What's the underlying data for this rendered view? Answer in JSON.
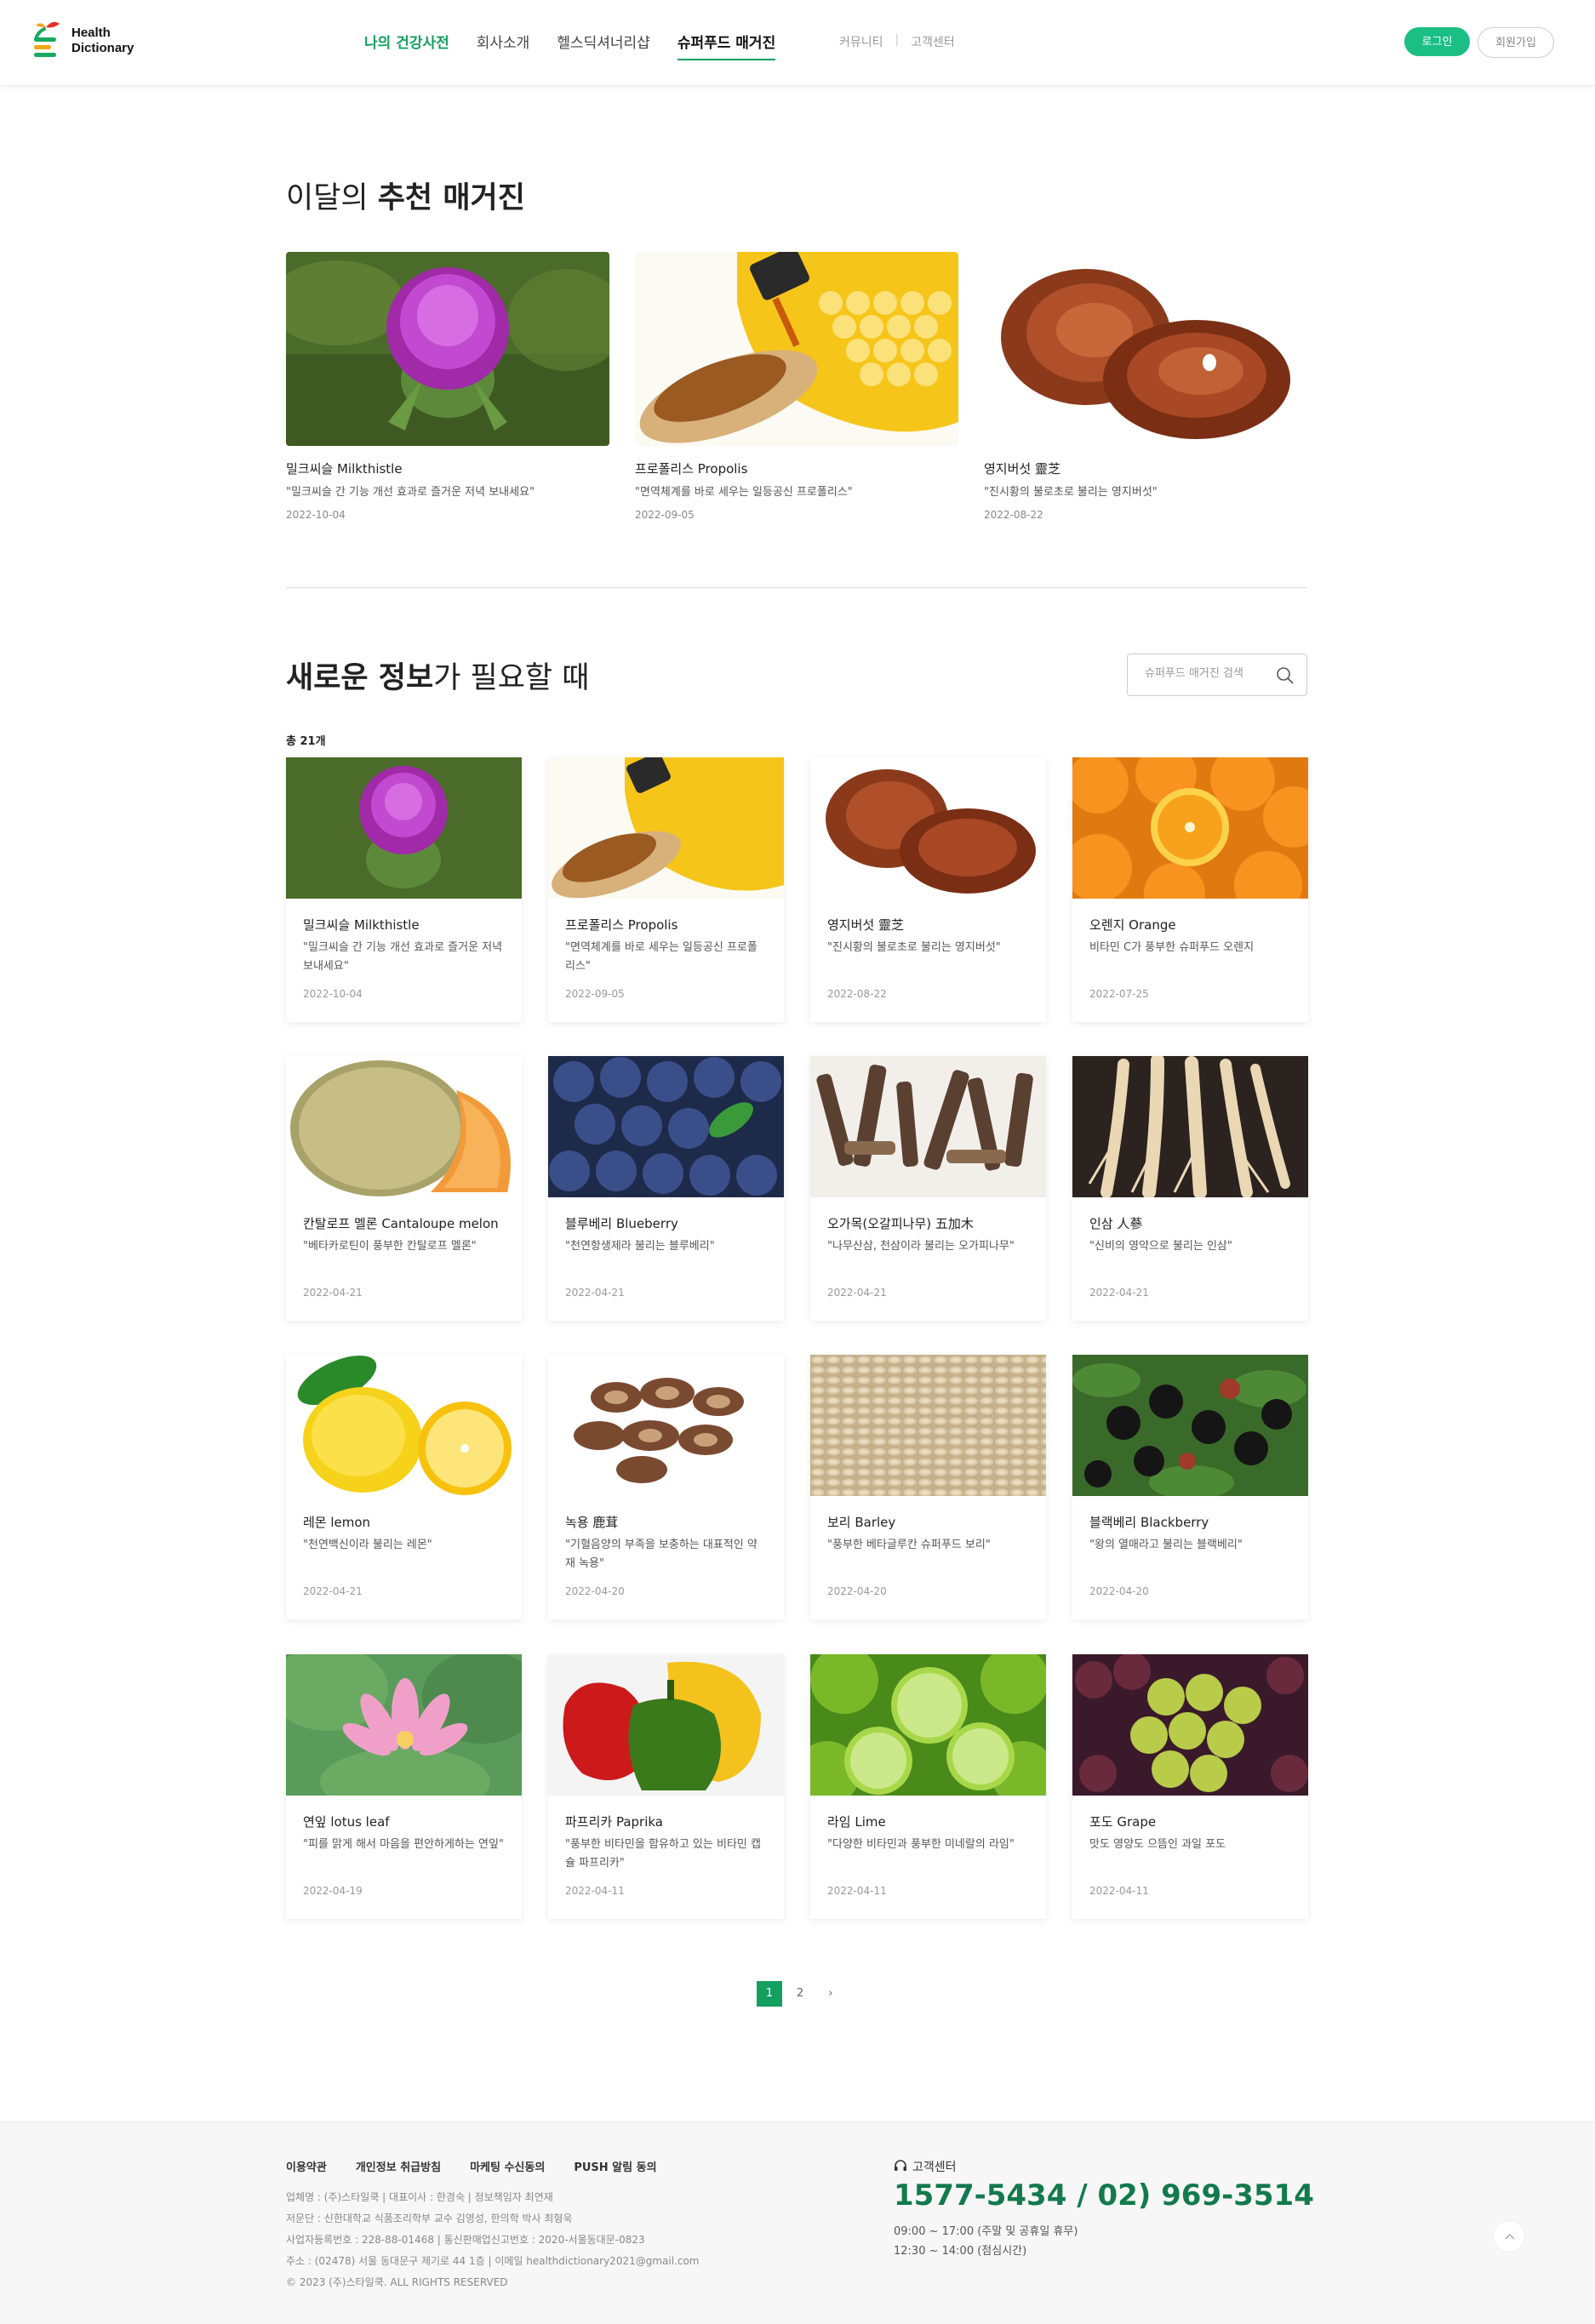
{
  "header": {
    "logo_line1": "Health",
    "logo_line2": "Dictionary",
    "nav": [
      "나의 건강사전",
      "회사소개",
      "헬스딕셔너리샵",
      "슈퍼푸드 매거진"
    ],
    "subnav": [
      "커뮤니티",
      "고객센터"
    ],
    "login": "로그인",
    "join": "회원가입"
  },
  "featured": {
    "title_prefix": "이달의 ",
    "title_bold": "추천 매거진",
    "items": [
      {
        "name": "밀크씨슬 Milkthistle",
        "desc": "\"밀크씨슬 간 기능 개선 효과로 즐거운 저녁 보내세요\"",
        "date": "2022-10-04",
        "icon": "milkthistle-image"
      },
      {
        "name": "프로폴리스 Propolis",
        "desc": "\"면역체계를 바로 세우는 일등공신 프로폴리스\"",
        "date": "2022-09-05",
        "icon": "propolis-image"
      },
      {
        "name": "영지버섯 靈芝",
        "desc": "\"진시황의 불로초로 불리는 영지버섯\"",
        "date": "2022-08-22",
        "icon": "reishi-image"
      }
    ]
  },
  "list": {
    "title_bold": "새로운 정보",
    "title_rest": "가 필요할 때",
    "search_placeholder": "슈퍼푸드 매거진 검색",
    "count": "총 21개",
    "items": [
      {
        "name": "밀크씨슬 Milkthistle",
        "desc": "\"밀크씨슬 간 기능 개선 효과로 즐거운 저녁 보내세요\"",
        "date": "2022-10-04"
      },
      {
        "name": "프로폴리스 Propolis",
        "desc": "\"면역체계를 바로 세우는 일등공신 프로폴리스\"",
        "date": "2022-09-05"
      },
      {
        "name": "영지버섯 靈芝",
        "desc": "\"진시황의 불로초로 불리는 영지버섯\"",
        "date": "2022-08-22"
      },
      {
        "name": "오렌지 Orange",
        "desc": "비타민 C가 풍부한 슈퍼푸드 오렌지",
        "date": "2022-07-25"
      },
      {
        "name": "칸탈로프 멜론 Cantaloupe melon",
        "desc": "\"베타카로틴이 풍부한 칸탈로프 멜론\"",
        "date": "2022-04-21"
      },
      {
        "name": "블루베리 Blueberry",
        "desc": "\"천연항생제라 불리는 블루베리\"",
        "date": "2022-04-21"
      },
      {
        "name": "오가목(오갈피나무) 五加木",
        "desc": "\"나무산삼, 천삼이라 불리는 오가피나무\"",
        "date": "2022-04-21"
      },
      {
        "name": "인삼 人蔘",
        "desc": "\"신비의 영약으로 불리는 인삼\"",
        "date": "2022-04-21"
      },
      {
        "name": "레몬 lemon",
        "desc": "\"천연백신이라 불리는 레몬\"",
        "date": "2022-04-21"
      },
      {
        "name": "녹용 鹿茸",
        "desc": "\"기혈음양의 부족을 보충하는 대표적인 약재 녹용\"",
        "date": "2022-04-20"
      },
      {
        "name": "보리 Barley",
        "desc": "\"풍부한 베타글루칸 슈퍼푸드 보리\"",
        "date": "2022-04-20"
      },
      {
        "name": "블랙베리 Blackberry",
        "desc": "\"왕의 열매라고 불리는 블랙베리\"",
        "date": "2022-04-20"
      },
      {
        "name": "연잎 lotus leaf",
        "desc": "\"피를 맑게 해서 마음을 편안하게하는 연잎\"",
        "date": "2022-04-19"
      },
      {
        "name": "파프리카 Paprika",
        "desc": "\"풍부한 비타민을 함유하고 있는 비타민 캡슐 파프리카\"",
        "date": "2022-04-11"
      },
      {
        "name": "라임 Lime",
        "desc": "\"다양한 비타민과 풍부한 미네랄의 라임\"",
        "date": "2022-04-11"
      },
      {
        "name": "포도 Grape",
        "desc": "맛도 영양도 으뜸인 과일 포도",
        "date": "2022-04-11"
      }
    ]
  },
  "pagination": {
    "pages": [
      "1",
      "2"
    ],
    "current": "1",
    "next": "›"
  },
  "footer": {
    "links": [
      "이용약관",
      "개인정보 취급방침",
      "마케팅 수신동의",
      "PUSH 알림 동의"
    ],
    "info_lines": [
      "업체명 : (주)스타일쿡   |   대표이사 : 한경숙   |   정보책임자 최연재",
      "저문단 : 신한대학교 식품조리학부 교수 김영성, 한의학 박사 최형욱",
      "사업자등록번호 : 228-88-01468   |   통신판매업신고번호 : 2020-서울동대문-0823",
      "주소 : (02478) 서울 동대문구 제기로 44 1층   |   이메일 healthdictionary2021@gmail.com",
      "© 2023 (주)스타일쿡. ALL RIGHTS RESERVED"
    ],
    "cs_label": "고객센터",
    "cs_phone": "1577-5434 / 02) 969-3514",
    "cs_hours1": "09:00 ~ 17:00 (주말 및 공휴일 휴무)",
    "cs_hours2": "12:30 ~ 14:00 (점심시간)"
  },
  "colors": {
    "brand_green": "#13a05f",
    "login_green": "#1bbf84",
    "phone_green": "#137a4d"
  }
}
